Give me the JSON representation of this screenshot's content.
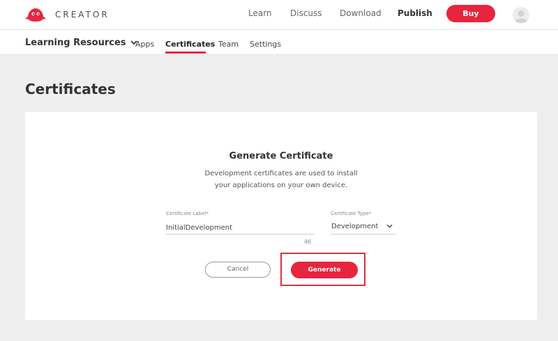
{
  "brand": {
    "name": "CREATOR",
    "logo_icon": "red-bird-logo-icon",
    "accent_color": "#e8253e"
  },
  "topnav": {
    "links": [
      "Learn",
      "Discuss",
      "Download",
      "Publish"
    ],
    "buy_label": "Buy",
    "avatar_icon": "user-avatar-icon"
  },
  "subnav": {
    "org_name": "Learning Resources",
    "tabs": [
      "Apps",
      "Certificates",
      "Team",
      "Settings"
    ],
    "active_tab": "Certificates"
  },
  "page": {
    "title": "Certificates"
  },
  "form": {
    "title": "Generate Certificate",
    "description_line1": "Development certificates are used to install",
    "description_line2": "your applications on your own device.",
    "label_field_label": "Certificate Label*",
    "label_value": "InitialDevelopment",
    "label_counter": "46",
    "type_field_label": "Certificate Type*",
    "type_value": "Development",
    "cancel_label": "Cancel",
    "generate_label": "Generate"
  }
}
